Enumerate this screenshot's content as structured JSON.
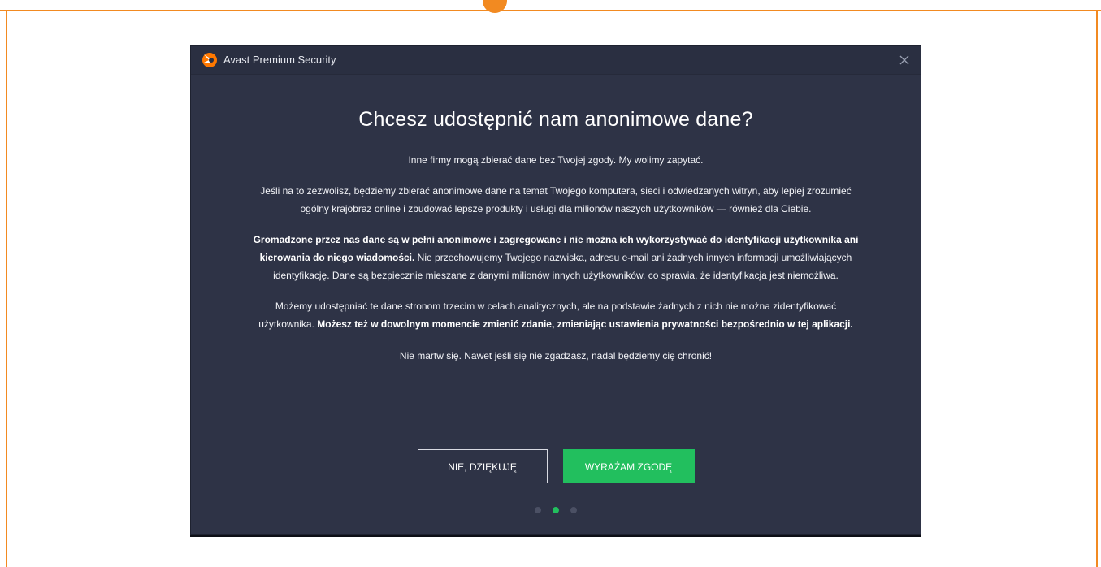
{
  "window": {
    "title": "Avast Premium Security",
    "close_icon": "close-icon"
  },
  "dialog": {
    "headline": "Chcesz udostępnić nam anonimowe dane?",
    "p1": "Inne firmy mogą zbierać dane bez Twojej zgody. My wolimy zapytać.",
    "p2": "Jeśli na to zezwolisz, będziemy zbierać anonimowe dane na temat Twojego komputera, sieci i odwiedzanych witryn, aby lepiej zrozumieć ogólny krajobraz online i zbudować lepsze produkty i usługi dla milionów naszych użytkowników — również dla Ciebie.",
    "p3_bold": "Gromadzone przez nas dane są w pełni anonimowe i zagregowane i nie można ich wykorzystywać do identyfikacji użytkownika ani kierowania do niego wiadomości.",
    "p3_rest": " Nie przechowujemy Twojego nazwiska, adresu e-mail ani żadnych innych informacji umożliwiających identyfikację. Dane są bezpiecznie mieszane z danymi milionów innych użytkowników, co sprawia, że identyfikacja jest niemożliwa.",
    "p4_start": "Możemy udostępniać te dane stronom trzecim w celach analitycznych, ale na podstawie żadnych z nich nie można zidentyfikować użytkownika. ",
    "p4_bold": "Możesz też w dowolnym momencie zmienić zdanie, zmieniając ustawienia prywatności bezpośrednio w tej aplikacji.",
    "p5": "Nie martw się. Nawet jeśli się nie zgadzasz, nadal będziemy cię chronić!",
    "decline_label": "NIE, DZIĘKUJĘ",
    "accept_label": "WYRAŻAM ZGODĘ"
  },
  "pagination": {
    "total": 3,
    "active_index": 1
  },
  "colors": {
    "frame_accent": "#f28a21",
    "dialog_bg": "#2e3346",
    "accept_green": "#22bf5e",
    "avast_orange": "#ff7800"
  }
}
